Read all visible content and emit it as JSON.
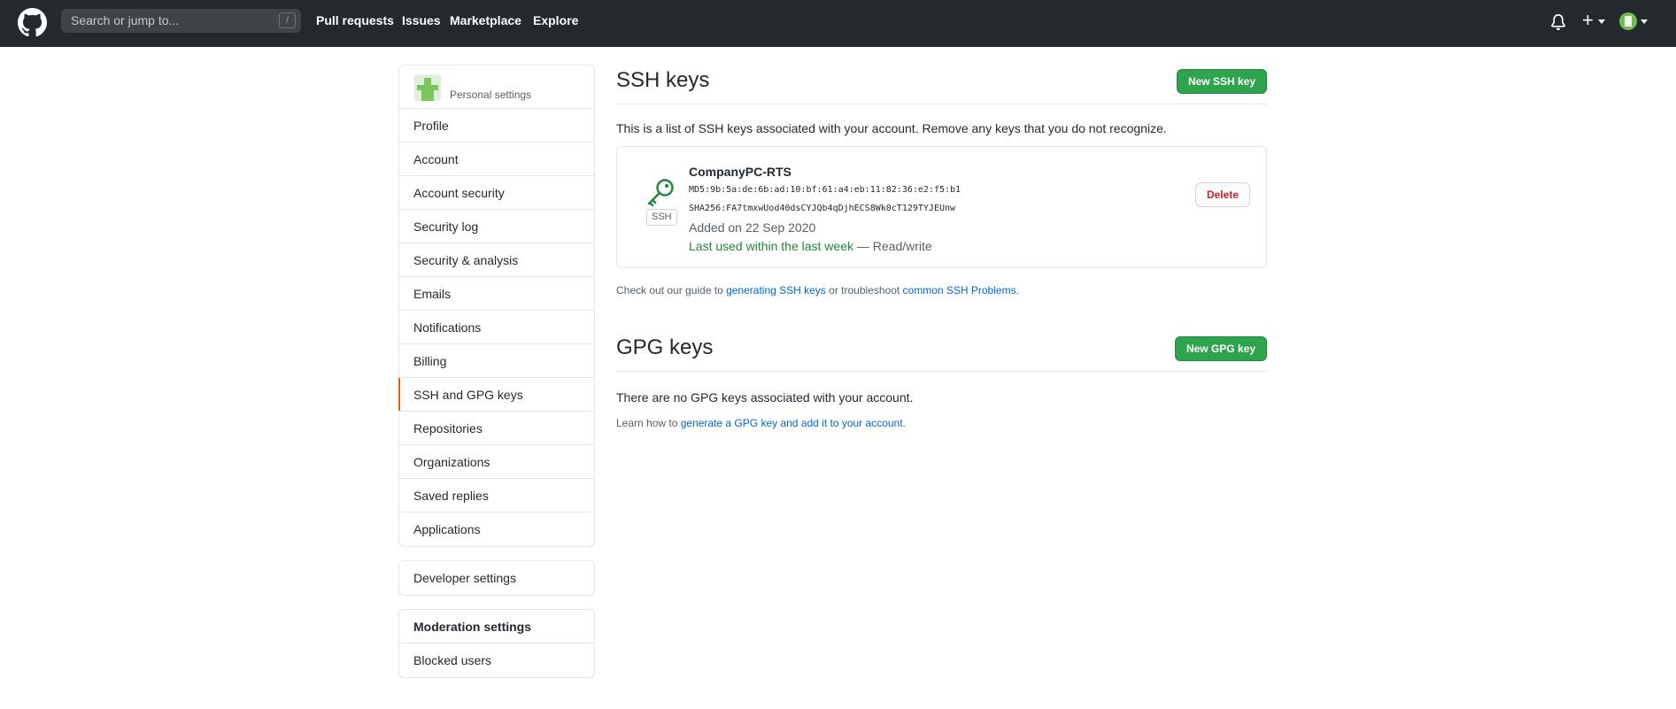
{
  "header": {
    "search_placeholder": "Search or jump to...",
    "search_shortcut": "/",
    "nav": [
      "Pull requests",
      "Issues",
      "Marketplace",
      "Explore"
    ],
    "icons": [
      "github-logo-icon",
      "bell-icon",
      "plus-icon",
      "avatar"
    ]
  },
  "sidebar": {
    "heading": "Personal settings",
    "items": [
      {
        "label": "Profile"
      },
      {
        "label": "Account"
      },
      {
        "label": "Account security"
      },
      {
        "label": "Security log"
      },
      {
        "label": "Security & analysis"
      },
      {
        "label": "Emails"
      },
      {
        "label": "Notifications"
      },
      {
        "label": "Billing"
      },
      {
        "label": "SSH and GPG keys",
        "active": true
      },
      {
        "label": "Repositories"
      },
      {
        "label": "Organizations"
      },
      {
        "label": "Saved replies"
      },
      {
        "label": "Applications"
      }
    ],
    "developer_settings": "Developer settings",
    "moderation_title": "Moderation settings",
    "blocked_users": "Blocked users"
  },
  "ssh": {
    "title": "SSH keys",
    "new_button": "New SSH key",
    "description": "This is a list of SSH keys associated with your account. Remove any keys that you do not recognize.",
    "key": {
      "badge": "SSH",
      "name": "CompanyPC-RTS",
      "md5": "MD5:9b:5a:de:6b:ad:10:bf:61:a4:eb:11:82:36:e2:f5:b1",
      "sha256": "SHA256:FA7tmxwUod40dsCYJQb4qDjhECS8Wk0cT129TYJEUnw",
      "added": "Added on 22 Sep 2020",
      "last_used": "Last used within the last week",
      "access": " — Read/write",
      "delete_button": "Delete"
    },
    "guide_prefix": "Check out our guide to ",
    "guide_link1": "generating SSH keys",
    "guide_mid": " or troubleshoot ",
    "guide_link2": "common SSH Problems",
    "guide_suffix": "."
  },
  "gpg": {
    "title": "GPG keys",
    "new_button": "New GPG key",
    "empty": "There are no GPG keys associated with your account.",
    "learn_prefix": "Learn how to ",
    "learn_link": "generate a GPG key and add it to your account",
    "learn_suffix": "."
  },
  "colors": {
    "header_bg": "#24292e",
    "primary_green": "#2ea44f",
    "link_blue": "#0366d6",
    "danger_red": "#cb2431",
    "active_marker": "#e36209"
  }
}
